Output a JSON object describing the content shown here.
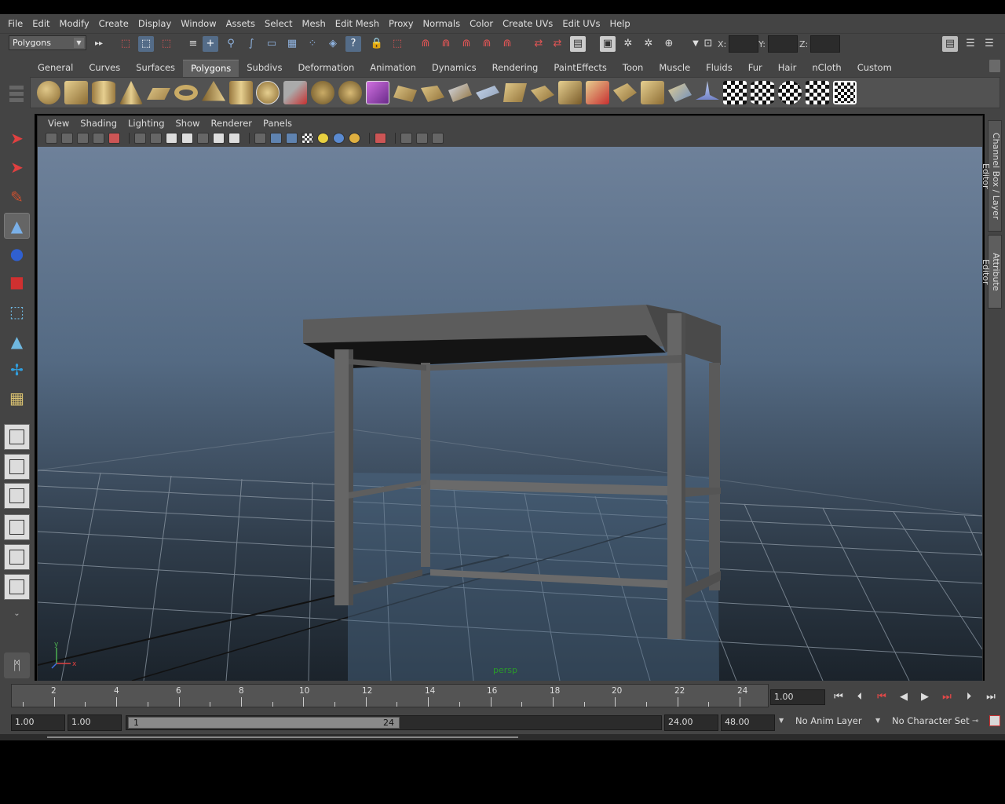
{
  "menubar": {
    "items": [
      "File",
      "Edit",
      "Modify",
      "Create",
      "Display",
      "Window",
      "Assets",
      "Select",
      "Mesh",
      "Edit Mesh",
      "Proxy",
      "Normals",
      "Color",
      "Create UVs",
      "Edit UVs",
      "Help"
    ]
  },
  "statusline": {
    "mode": "Polygons",
    "x_label": "X:",
    "y_label": "Y:",
    "z_label": "Z:"
  },
  "shelf": {
    "tabs": [
      "General",
      "Curves",
      "Surfaces",
      "Polygons",
      "Subdivs",
      "Deformation",
      "Animation",
      "Dynamics",
      "Rendering",
      "PaintEffects",
      "Toon",
      "Muscle",
      "Fluids",
      "Fur",
      "Hair",
      "nCloth",
      "Custom"
    ],
    "active_tab": "Polygons"
  },
  "viewport": {
    "menu": [
      "View",
      "Shading",
      "Lighting",
      "Show",
      "Renderer",
      "Panels"
    ],
    "camera_label": "persp",
    "axis_y": "y",
    "axis_x": "x"
  },
  "sidepanel": {
    "channel_box_tab": "Channel Box / Layer Editor",
    "attribute_editor_tab": "Attribute Editor"
  },
  "timeslider": {
    "ticks": [
      "2",
      "4",
      "6",
      "8",
      "10",
      "12",
      "14",
      "16",
      "18",
      "20",
      "22",
      "24"
    ],
    "current_frame": "1.00"
  },
  "range": {
    "start_time": "1.00",
    "playback_start": "1.00",
    "range_start_label": "1",
    "range_end_label": "24",
    "playback_end": "24.00",
    "end_time": "48.00",
    "anim_layer": "No Anim Layer",
    "character_set": "No Character Set"
  },
  "colors": {
    "ui_bg": "#444444",
    "viewport_top": "#6e819a",
    "viewport_bottom": "#1b232b",
    "camera_label": "#2a9a2a",
    "playback_red": "#e04848"
  }
}
